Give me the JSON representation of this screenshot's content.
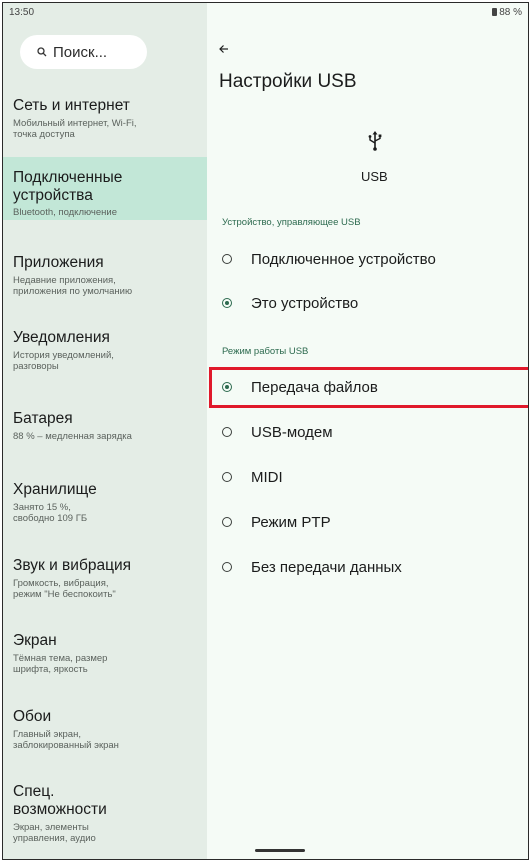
{
  "status_bar": {
    "time": "13:50",
    "battery": "88 %"
  },
  "search": {
    "placeholder": "Поиск..."
  },
  "nav": [
    {
      "title": "Сеть и интернет",
      "subtitle_line1": "Мобильный интернет, Wi-Fi,",
      "subtitle_line2": "точка доступа"
    },
    {
      "title_line1": "Подключенные",
      "title_line2": "устройства",
      "subtitle": "Bluetooth, подключение",
      "active": true
    },
    {
      "title": "Приложения",
      "subtitle_line1": "Недавние приложения,",
      "subtitle_line2": "приложения по умолчанию"
    },
    {
      "title": "Уведомления",
      "subtitle_line1": "История уведомлений,",
      "subtitle_line2": "разговоры"
    },
    {
      "title": "Батарея",
      "subtitle": "88 % – медленная зарядка"
    },
    {
      "title": "Хранилище",
      "subtitle_line1": "Занято 15 %,",
      "subtitle_line2": "свободно 109 ГБ"
    },
    {
      "title": "Звук и вибрация",
      "subtitle_line1": "Громкость, вибрация,",
      "subtitle_line2": "режим \"Не беспокоить\""
    },
    {
      "title": "Экран",
      "subtitle_line1": "Тёмная тема, размер",
      "subtitle_line2": "шрифта, яркость"
    },
    {
      "title": "Обои",
      "subtitle_line1": "Главный экран,",
      "subtitle_line2": "заблокированный экран"
    },
    {
      "title_line1": "Спец.",
      "title_line2": "возможности",
      "subtitle_line1": "Экран, элементы",
      "subtitle_line2": "управления, аудио"
    }
  ],
  "page": {
    "back_icon": "arrow-left-icon",
    "title": "Настройки USB",
    "usb_icon": "usb-icon",
    "usb_label": "USB",
    "section_controller": "Устройство, управляющее USB",
    "controller_options": [
      {
        "label": "Подключенное устройство",
        "selected": false
      },
      {
        "label": "Это устройство",
        "selected": true
      }
    ],
    "section_mode": "Режим работы USB",
    "mode_options": [
      {
        "label": "Передача файлов",
        "selected": true
      },
      {
        "label": "USB-модем",
        "selected": false
      },
      {
        "label": "MIDI",
        "selected": false
      },
      {
        "label": "Режим PTP",
        "selected": false
      },
      {
        "label": "Без передачи данных",
        "selected": false
      }
    ]
  },
  "colors": {
    "accent": "#2d6a4f",
    "highlight": "#e0192b",
    "sidebar_bg": "#e4ede6",
    "active_bg": "#c2e7d7"
  }
}
